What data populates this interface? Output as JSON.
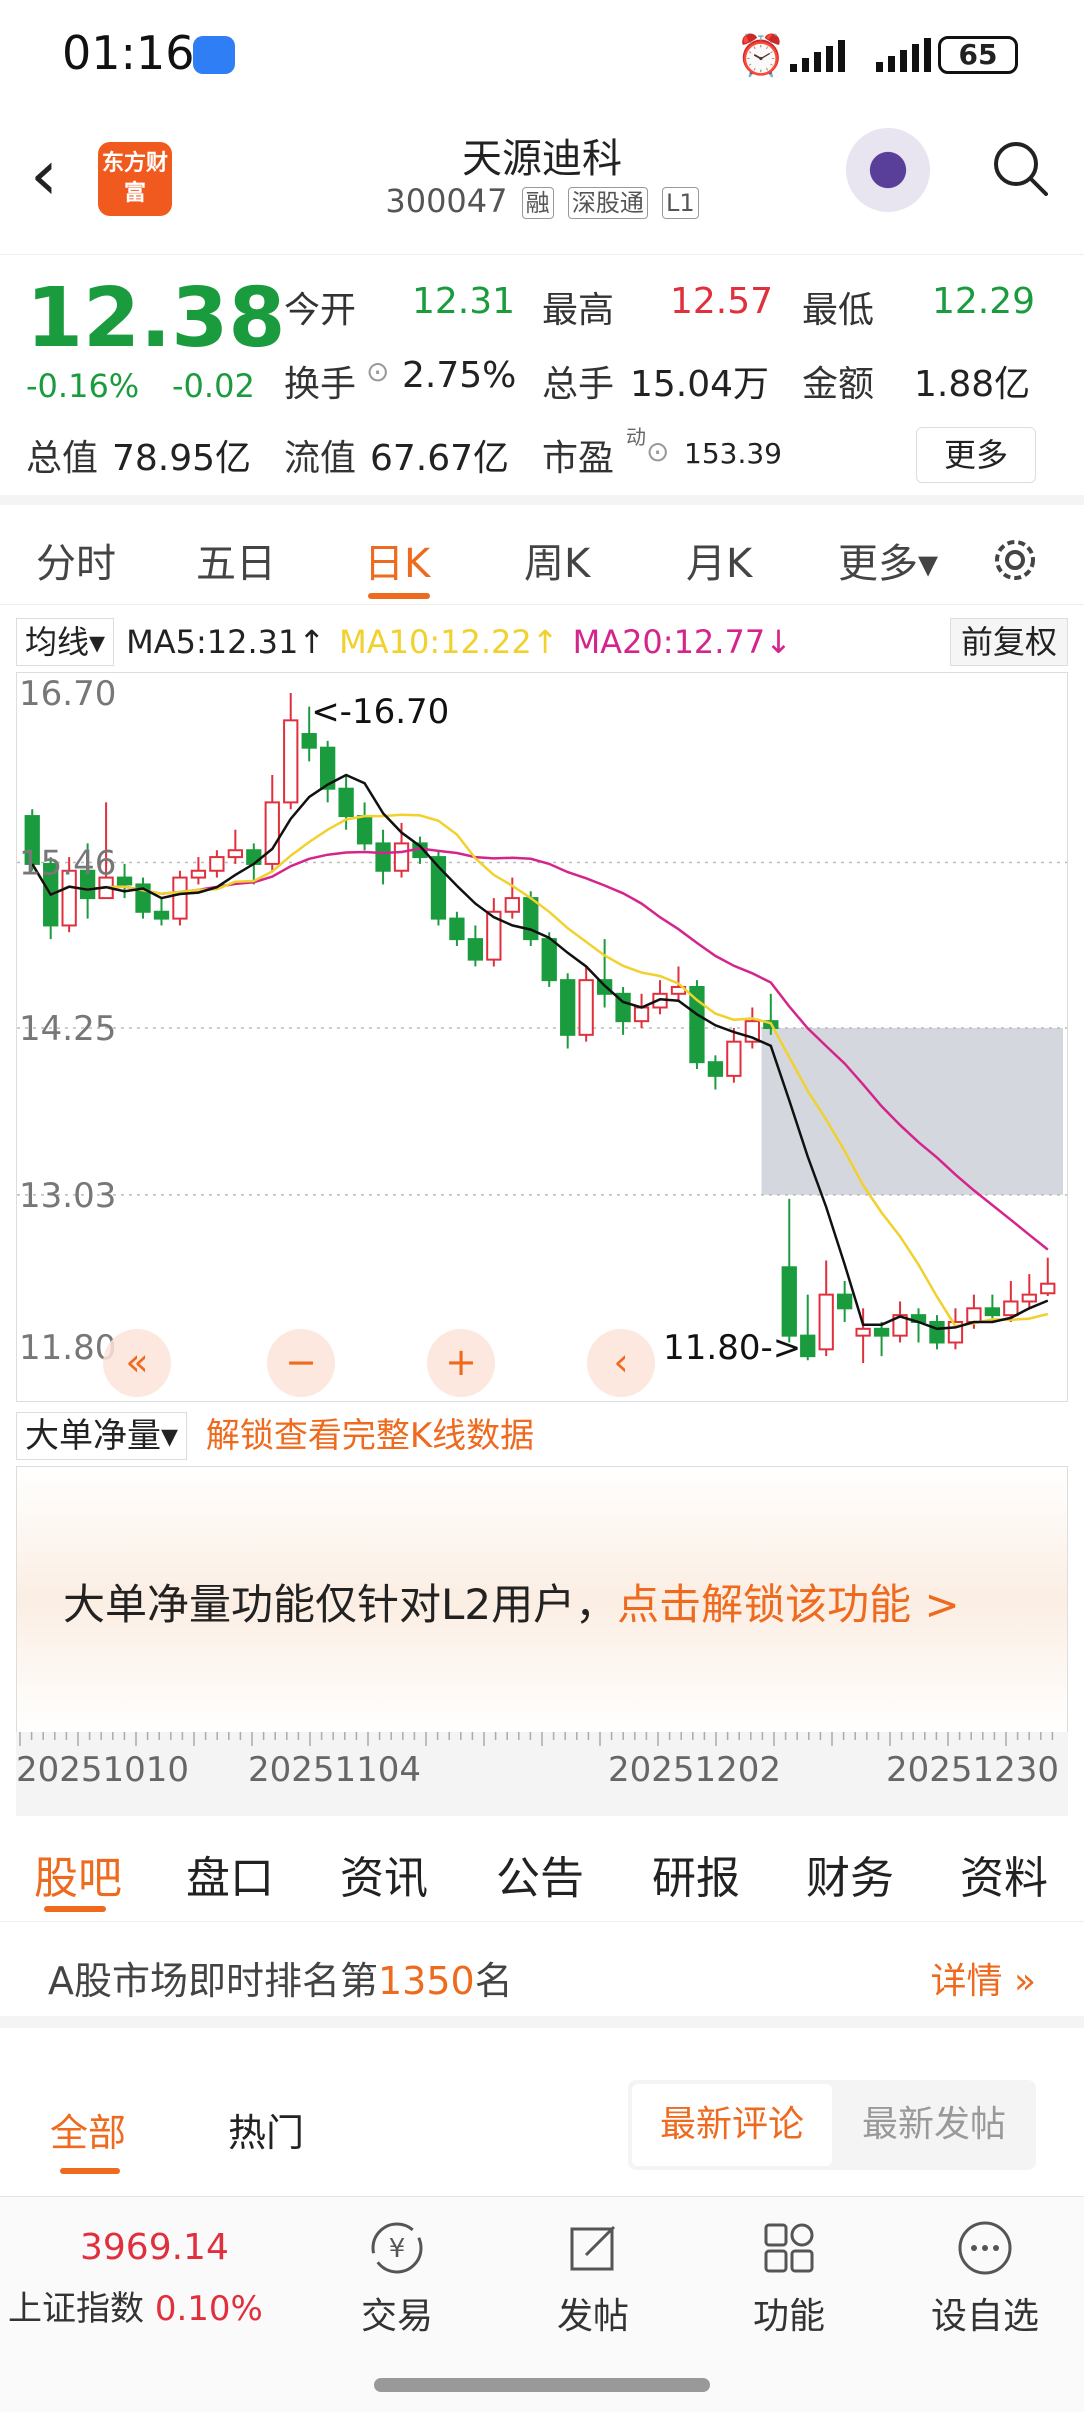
{
  "status_bar": {
    "time": "01:16",
    "battery": "65"
  },
  "header": {
    "logo_text": "东方财富",
    "stock_name": "天源迪科",
    "stock_code": "300047",
    "tags": [
      "融",
      "深股通",
      "L1"
    ]
  },
  "quote": {
    "price": "12.38",
    "change_pct": "-0.16%",
    "change": "-0.02",
    "open_label": "今开",
    "open": "12.31",
    "high_label": "最高",
    "high": "12.57",
    "low_label": "最低",
    "low": "12.29",
    "turnover_label": "换手",
    "turnover": "2.75%",
    "volume_label": "总手",
    "volume": "15.04万",
    "amount_label": "金额",
    "amount": "1.88亿",
    "mktcap_label": "总值",
    "mktcap": "78.95亿",
    "float_label": "流值",
    "float": "67.67亿",
    "pe_label": "市盈",
    "pe_sup": "动",
    "pe": "153.39",
    "more": "更多"
  },
  "chart_tabs": [
    "分时",
    "五日",
    "日K",
    "周K",
    "月K",
    "更多▾"
  ],
  "ma": {
    "box": "均线▾",
    "ma5": "MA5:12.31↑",
    "ma10": "MA10:12.22↑",
    "ma20": "MA20:12.77↓",
    "adjust": "前复权"
  },
  "chart_data": {
    "type": "candlestick",
    "y_ticks": [
      "16.70",
      "15.46",
      "14.25",
      "13.03",
      "11.80"
    ],
    "ylim": [
      11.8,
      16.7
    ],
    "max_annotation": "<-16.70",
    "min_annotation": "11.80->",
    "x_ticks": [
      "20251010",
      "20251104",
      "20251202",
      "20251230"
    ],
    "colors": {
      "up": "#e0303d",
      "down": "#1a9c3e",
      "ma5": "#111111",
      "ma10": "#f1d12e",
      "ma20": "#d4258c",
      "gap": "#d4d7dd"
    },
    "gap_zone": [
      13.03,
      14.25
    ],
    "candles": [
      [
        15.8,
        15.45,
        15.85,
        15.4
      ],
      [
        15.45,
        15.0,
        15.5,
        14.9
      ],
      [
        15.0,
        15.4,
        15.5,
        14.95
      ],
      [
        15.4,
        15.2,
        15.6,
        15.05
      ],
      [
        15.2,
        15.35,
        15.9,
        15.2
      ],
      [
        15.35,
        15.3,
        15.45,
        15.2
      ],
      [
        15.3,
        15.1,
        15.35,
        15.05
      ],
      [
        15.1,
        15.05,
        15.2,
        15.0
      ],
      [
        15.05,
        15.35,
        15.4,
        15.0
      ],
      [
        15.35,
        15.4,
        15.5,
        15.3
      ],
      [
        15.4,
        15.5,
        15.55,
        15.35
      ],
      [
        15.5,
        15.55,
        15.7,
        15.45
      ],
      [
        15.55,
        15.45,
        15.6,
        15.3
      ],
      [
        15.45,
        15.9,
        16.1,
        15.4
      ],
      [
        15.9,
        16.5,
        16.7,
        15.85
      ],
      [
        16.4,
        16.3,
        16.6,
        16.2
      ],
      [
        16.3,
        16.0,
        16.35,
        15.9
      ],
      [
        16.0,
        15.8,
        16.1,
        15.7
      ],
      [
        15.8,
        15.6,
        15.9,
        15.55
      ],
      [
        15.6,
        15.4,
        15.7,
        15.3
      ],
      [
        15.4,
        15.6,
        15.75,
        15.35
      ],
      [
        15.6,
        15.5,
        15.65,
        15.45
      ],
      [
        15.5,
        15.05,
        15.55,
        15.0
      ],
      [
        15.05,
        14.9,
        15.1,
        14.85
      ],
      [
        14.9,
        14.75,
        15.0,
        14.7
      ],
      [
        14.75,
        15.1,
        15.2,
        14.7
      ],
      [
        15.1,
        15.2,
        15.35,
        15.05
      ],
      [
        15.2,
        14.9,
        15.25,
        14.85
      ],
      [
        14.9,
        14.6,
        14.95,
        14.55
      ],
      [
        14.6,
        14.2,
        14.65,
        14.1
      ],
      [
        14.2,
        14.6,
        14.7,
        14.15
      ],
      [
        14.6,
        14.5,
        14.9,
        14.4
      ],
      [
        14.5,
        14.3,
        14.55,
        14.2
      ],
      [
        14.3,
        14.4,
        14.5,
        14.25
      ],
      [
        14.4,
        14.5,
        14.6,
        14.35
      ],
      [
        14.5,
        14.55,
        14.7,
        14.45
      ],
      [
        14.55,
        14.0,
        14.6,
        13.95
      ],
      [
        14.0,
        13.9,
        14.05,
        13.8
      ],
      [
        13.9,
        14.15,
        14.25,
        13.85
      ],
      [
        14.15,
        14.3,
        14.4,
        14.1
      ],
      [
        14.3,
        14.25,
        14.5,
        14.2
      ],
      [
        12.5,
        12.0,
        13.0,
        11.95
      ],
      [
        12.0,
        11.85,
        12.3,
        11.82
      ],
      [
        11.9,
        12.3,
        12.55,
        11.85
      ],
      [
        12.3,
        12.2,
        12.4,
        12.1
      ],
      [
        12.0,
        12.05,
        12.2,
        11.8
      ],
      [
        12.05,
        12.0,
        12.1,
        11.85
      ],
      [
        12.0,
        12.15,
        12.25,
        11.95
      ],
      [
        12.15,
        12.1,
        12.2,
        11.95
      ],
      [
        12.1,
        11.95,
        12.15,
        11.9
      ],
      [
        11.95,
        12.1,
        12.2,
        11.9
      ],
      [
        12.1,
        12.2,
        12.3,
        12.05
      ],
      [
        12.2,
        12.15,
        12.3,
        12.1
      ],
      [
        12.15,
        12.25,
        12.4,
        12.1
      ],
      [
        12.25,
        12.3,
        12.45,
        12.2
      ],
      [
        12.31,
        12.38,
        12.57,
        12.29
      ]
    ]
  },
  "volume": {
    "box": "大单净量▾",
    "unlock": "解锁查看完整K线数据",
    "tip": "大单净量功能仅针对L2用户，",
    "tip_link": "点击解锁该功能 >"
  },
  "section_tabs": [
    "股吧",
    "盘口",
    "资讯",
    "公告",
    "研报",
    "财务",
    "资料"
  ],
  "rank": {
    "prefix": "A股市场即时排名第",
    "number": "1350",
    "suffix": "名",
    "detail": "详情 »"
  },
  "forum_tabs": [
    "全部",
    "热门"
  ],
  "forum_seg": [
    "最新评论",
    "最新发帖"
  ],
  "bottom_nav": {
    "index_value": "3969.14",
    "index_name": "上证指数",
    "index_pct": "0.10%",
    "items": [
      "交易",
      "发帖",
      "功能",
      "设自选"
    ]
  }
}
